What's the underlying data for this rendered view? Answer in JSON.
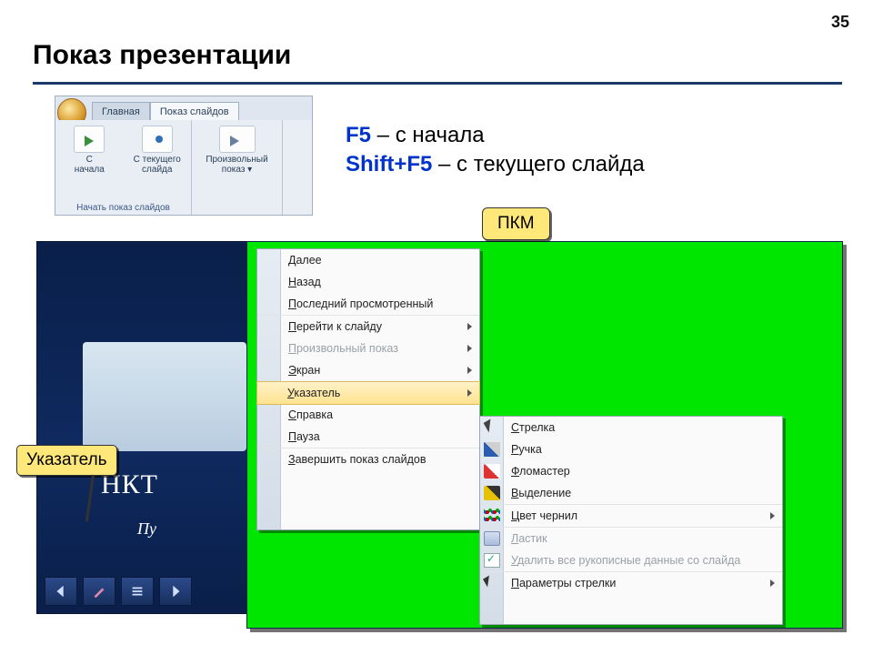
{
  "page_number": "35",
  "title": "Показ презентации",
  "ribbon": {
    "tab_home": "Главная",
    "tab_slideshow": "Показ слайдов",
    "btn_from_start": "С\nначала",
    "btn_from_current": "С текущего\nслайда",
    "btn_custom": "Произвольный\nпоказ ▾",
    "group_label": "Начать показ слайдов"
  },
  "hotkeys": {
    "k1": "F5",
    "t1": " – с начала",
    "k2": "Shift+F5",
    "t2": " – с текущего слайда"
  },
  "callouts": {
    "pkm": "ПКМ",
    "pointer": "Указатель"
  },
  "slideshow": {
    "title_fragment": "НКТ",
    "subtitle_fragment": "Пу"
  },
  "context_menu_main": [
    {
      "label": "Далее",
      "interact": true
    },
    {
      "label": "Назад",
      "interact": true
    },
    {
      "label": "Последний просмотренный",
      "interact": true,
      "sep": true
    },
    {
      "label": "Перейти к слайду",
      "interact": true,
      "submenu": true
    },
    {
      "label": "Произвольный показ",
      "interact": false,
      "disabled": true,
      "submenu": true
    },
    {
      "label": "Экран",
      "interact": true,
      "submenu": true,
      "sep": true
    },
    {
      "label": "Указатель",
      "interact": true,
      "submenu": true,
      "highlight": true,
      "sep": true
    },
    {
      "label": "Справка",
      "interact": true
    },
    {
      "label": "Пауза",
      "interact": true,
      "sep": true
    },
    {
      "label": "Завершить показ слайдов",
      "interact": true
    }
  ],
  "context_menu_sub": [
    {
      "label": "Стрелка",
      "icon": "ic-arrow",
      "interact": true
    },
    {
      "label": "Ручка",
      "icon": "ic-pen",
      "interact": true
    },
    {
      "label": "Фломастер",
      "icon": "ic-marker",
      "interact": true
    },
    {
      "label": "Выделение",
      "icon": "ic-high",
      "interact": true,
      "sep": true
    },
    {
      "label": "Цвет чернил",
      "icon": "ic-ink",
      "interact": true,
      "submenu": true,
      "sep": true
    },
    {
      "label": "Ластик",
      "icon": "ic-eraser",
      "interact": false,
      "disabled": true
    },
    {
      "label": "Удалить все рукописные данные со слайда",
      "icon": "ic-del",
      "interact": false,
      "disabled": true,
      "sep": true
    },
    {
      "label": "Параметры стрелки",
      "icon": "ic-opt",
      "interact": true,
      "submenu": true
    }
  ]
}
